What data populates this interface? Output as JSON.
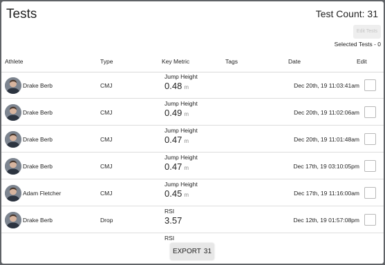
{
  "title": "Tests",
  "test_count_label": "Test Count: 31",
  "edit_tests_label": "Edit Tests",
  "selected_tests_label": "Selected Tests - 0",
  "columns": {
    "athlete": "Athlete",
    "type": "Type",
    "key_metric": "Key Metric",
    "tags": "Tags",
    "date": "Date",
    "edit": "Edit"
  },
  "rows": [
    {
      "athlete": "Drake Berb",
      "type": "CMJ",
      "metric_name": "Jump Height",
      "metric_value": "0.48",
      "metric_unit": "m",
      "date": "Dec 20th, 19 11:03:41am"
    },
    {
      "athlete": "Drake Berb",
      "type": "CMJ",
      "metric_name": "Jump Height",
      "metric_value": "0.49",
      "metric_unit": "m",
      "date": "Dec 20th, 19 11:02:06am"
    },
    {
      "athlete": "Drake Berb",
      "type": "CMJ",
      "metric_name": "Jump Height",
      "metric_value": "0.47",
      "metric_unit": "m",
      "date": "Dec 20th, 19 11:01:48am"
    },
    {
      "athlete": "Drake Berb",
      "type": "CMJ",
      "metric_name": "Jump Height",
      "metric_value": "0.47",
      "metric_unit": "m",
      "date": "Dec 17th, 19 03:10:05pm"
    },
    {
      "athlete": "Adam Fletcher",
      "type": "CMJ",
      "metric_name": "Jump Height",
      "metric_value": "0.45",
      "metric_unit": "m",
      "date": "Dec 17th, 19 11:16:00am"
    },
    {
      "athlete": "Drake Berb",
      "type": "Drop",
      "metric_name": "RSI",
      "metric_value": "3.57",
      "metric_unit": "",
      "date": "Dec 12th, 19 01:57:08pm"
    },
    {
      "athlete": "",
      "type": "",
      "metric_name": "RSI",
      "metric_value": "",
      "metric_unit": "",
      "date": ""
    }
  ],
  "export": {
    "label": "EXPORT",
    "count": "31"
  }
}
